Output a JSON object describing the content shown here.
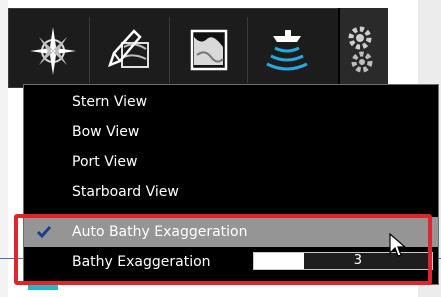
{
  "toolbar": {
    "buttons": [
      {
        "name": "compass-rose-icon"
      },
      {
        "name": "chart-edit-icon"
      },
      {
        "name": "map-layers-icon"
      },
      {
        "name": "sonar-boat-icon"
      }
    ],
    "overflow_icon": "gears-icon"
  },
  "menu": {
    "items": [
      {
        "label": "Stern View"
      },
      {
        "label": "Bow View"
      },
      {
        "label": "Port View"
      },
      {
        "label": "Starboard View"
      },
      {
        "label": "Auto Bathy Exaggeration",
        "checked": true
      },
      {
        "label": "Bathy Exaggeration",
        "value": "3",
        "fill_fraction": 0.28
      }
    ]
  },
  "colors": {
    "highlight": "#e0262b",
    "menu_bg": "#000000",
    "checked_bg": "#959595",
    "sonar_accent": "#26a9e0"
  }
}
